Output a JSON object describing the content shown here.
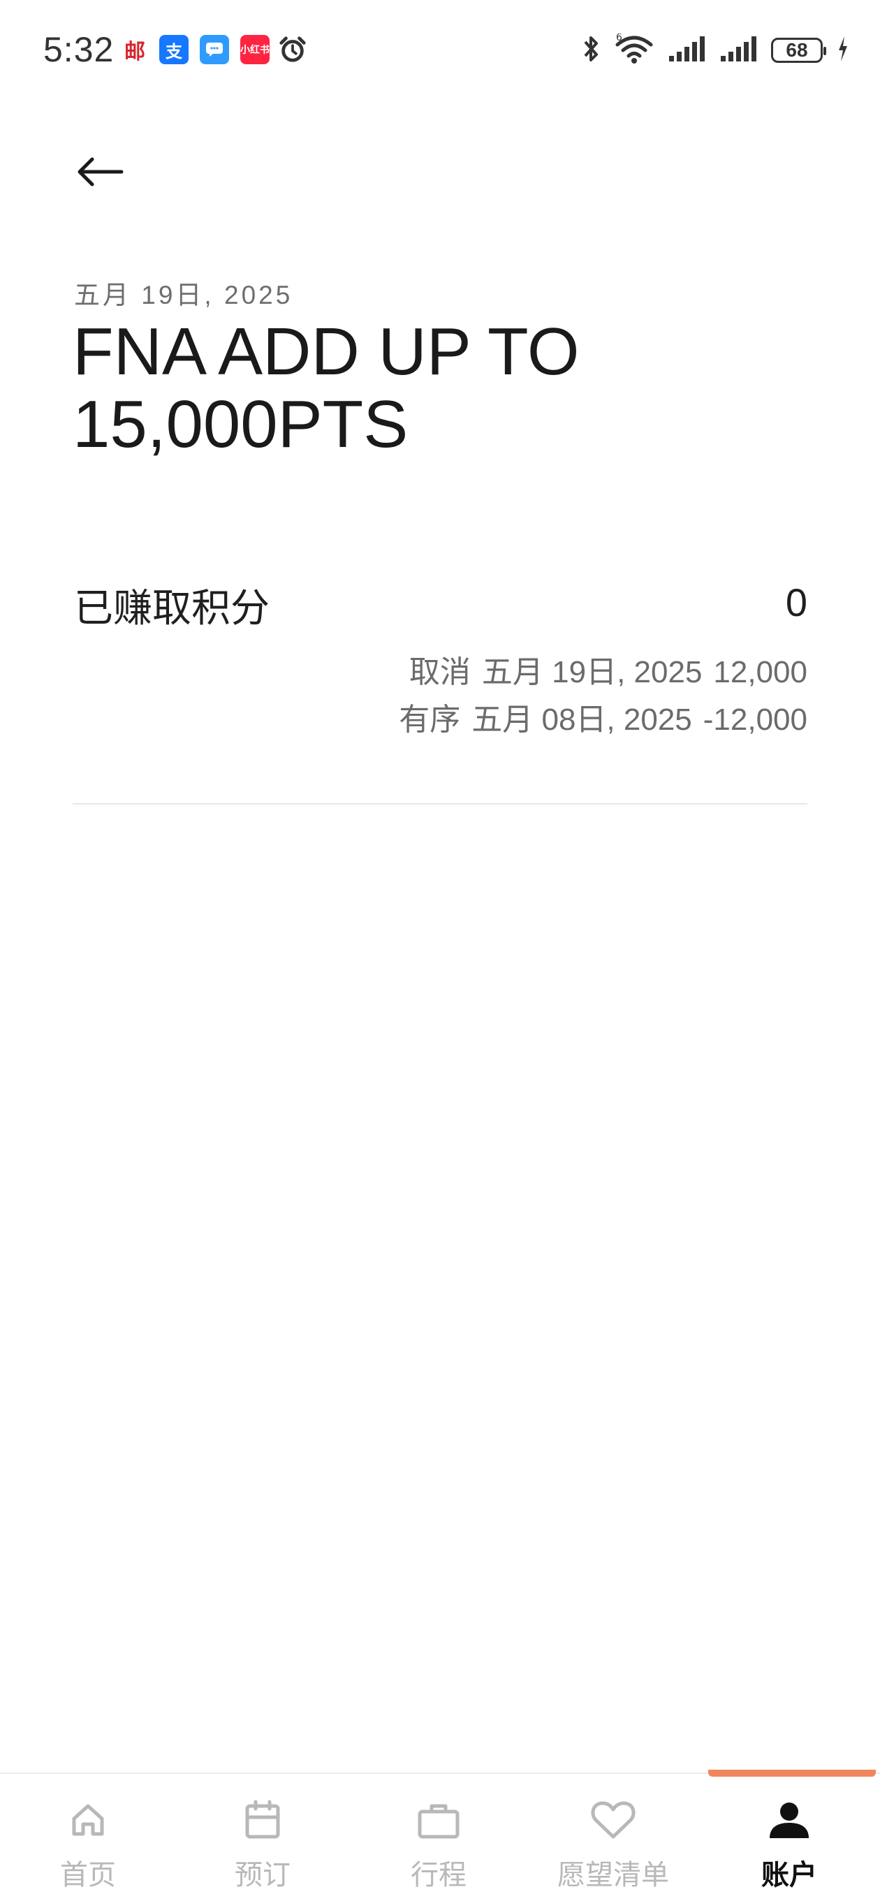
{
  "status_bar": {
    "time": "5:32",
    "apps": [
      "post-app-icon",
      "alipay-icon",
      "message-app-icon",
      "xiaohongshu-icon",
      "alarm-icon"
    ],
    "app_glyphs": {
      "post": "邮",
      "alipay": "支",
      "xhs": "小红书"
    },
    "network": "6",
    "battery": "68"
  },
  "header": {
    "back_icon": "arrow-left-icon",
    "date": "五月 19日, 2025",
    "title": "FNA ADD UP TO 15,000PTS"
  },
  "points": {
    "label": "已赚取积分",
    "value": "0",
    "transactions": [
      {
        "status": "取消",
        "date": "五月 19日, 2025",
        "amount": "12,000"
      },
      {
        "status": "有序",
        "date": "五月 08日, 2025",
        "amount": "-12,000"
      }
    ]
  },
  "bottom_nav": {
    "items": [
      {
        "label": "首页",
        "icon": "home-icon"
      },
      {
        "label": "预订",
        "icon": "calendar-icon"
      },
      {
        "label": "行程",
        "icon": "suitcase-icon"
      },
      {
        "label": "愿望清单",
        "icon": "heart-icon"
      },
      {
        "label": "账户",
        "icon": "person-icon"
      }
    ],
    "active_index": 4
  },
  "colors": {
    "accent": "#f0865e",
    "text_primary": "#1a1a1a",
    "text_secondary": "#6b6b6b",
    "nav_inactive": "#b8b8b8"
  }
}
